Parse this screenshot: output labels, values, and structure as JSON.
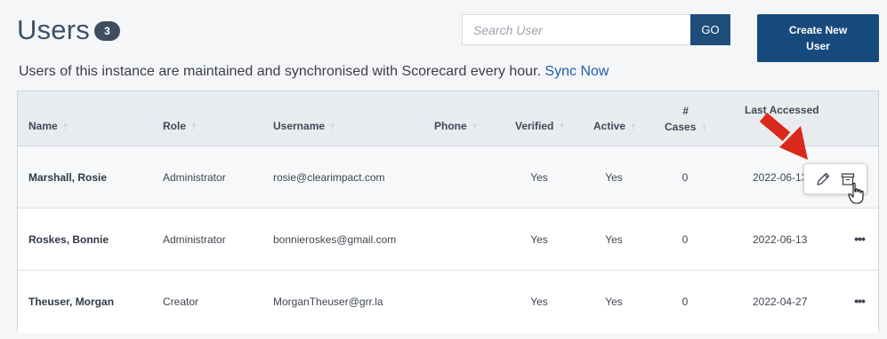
{
  "header": {
    "title": "Users",
    "count": "3",
    "subtitle": "Users of this instance are maintained and synchronised with Scorecard every hour.",
    "sync_link": "Sync Now"
  },
  "search": {
    "placeholder": "Search User",
    "value": "",
    "go_label": "GO"
  },
  "create_button_label": "Create New User",
  "table": {
    "columns": {
      "name": "Name",
      "role": "Role",
      "username": "Username",
      "phone": "Phone",
      "verified": "Verified",
      "active": "Active",
      "cases_line1": "#",
      "cases_line2": "Cases",
      "last_accessed": "Last Accessed",
      "sort_icon": "↑"
    },
    "rows": [
      {
        "name": "Marshall, Rosie",
        "role": "Administrator",
        "username": "rosie@clearimpact.com",
        "phone": "",
        "verified": "Yes",
        "active": "Yes",
        "cases": "0",
        "last_accessed": "2022-06-13"
      },
      {
        "name": "Roskes, Bonnie",
        "role": "Administrator",
        "username": "bonnieroskes@gmail.com",
        "phone": "",
        "verified": "Yes",
        "active": "Yes",
        "cases": "0",
        "last_accessed": "2022-06-13"
      },
      {
        "name": "Theuser, Morgan",
        "role": "Creator",
        "username": "MorganTheuser@grr.la",
        "phone": "",
        "verified": "Yes",
        "active": "Yes",
        "cases": "0",
        "last_accessed": "2022-04-27"
      }
    ],
    "more_icon": "•••"
  },
  "actions_popover": {
    "edit_icon": "pencil-icon",
    "archive_icon": "archive-icon"
  },
  "colors": {
    "primary": "#174a7c",
    "badge": "#3f4d5f",
    "link": "#1e5fa8",
    "annotation_arrow": "#d9281c"
  }
}
